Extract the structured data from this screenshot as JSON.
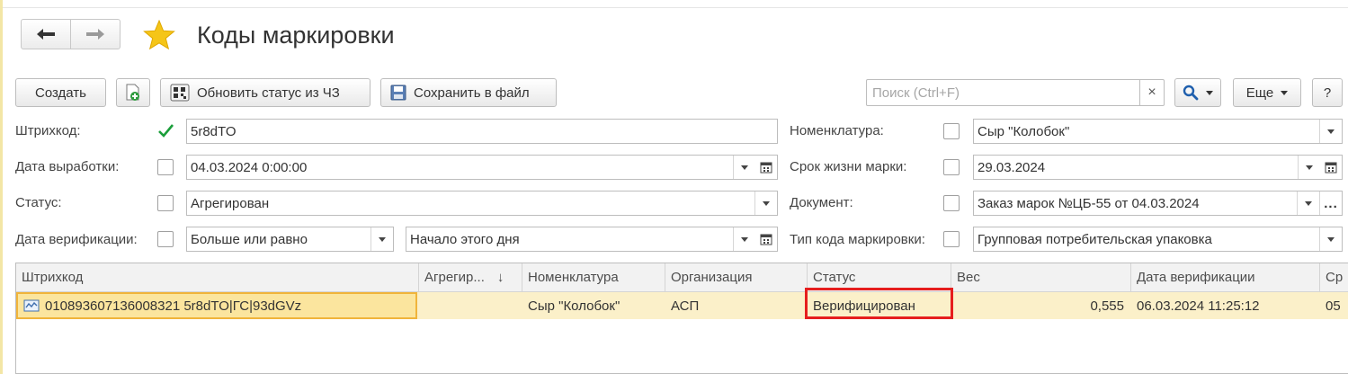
{
  "window": {
    "title": "Коды маркировки"
  },
  "toolbar": {
    "create_label": "Создать",
    "update_status_label": "Обновить статус из ЧЗ",
    "save_file_label": "Сохранить в файл",
    "search_placeholder": "Поиск (Ctrl+F)",
    "clear_symbol": "×",
    "more_label": "Еще",
    "help_label": "?"
  },
  "filters": {
    "barcode": {
      "label": "Штрихкод:",
      "checked": true,
      "value": "5r8dTO"
    },
    "production_date": {
      "label": "Дата выработки:",
      "checked": false,
      "value": "04.03.2024  0:00:00"
    },
    "status": {
      "label": "Статус:",
      "checked": false,
      "value": "Агрегирован"
    },
    "verification_date": {
      "label": "Дата верификации:",
      "checked": false,
      "condition": "Больше или равно",
      "value": "Начало этого дня"
    },
    "nomenclature": {
      "label": "Номенклатура:",
      "checked": false,
      "value": "Сыр \"Колобок\""
    },
    "mark_lifetime": {
      "label": "Срок жизни марки:",
      "checked": false,
      "value": "29.03.2024"
    },
    "document": {
      "label": "Документ:",
      "checked": false,
      "value": "Заказ марок №ЦБ-55 от 04.03.2024",
      "more": "..."
    },
    "code_type": {
      "label": "Тип кода маркировки:",
      "checked": false,
      "value": "Групповая потребительская упаковка"
    }
  },
  "table": {
    "columns": [
      "Штрихкод",
      "Агрегир...",
      "Номенклатура",
      "Организация",
      "Статус",
      "Вес",
      "Дата верификации",
      "Ср"
    ],
    "sort_indicator": "↓",
    "rows": [
      {
        "barcode": "010893607136008321 5r8dTO|ГС|93dGVz",
        "aggregated": "",
        "nomenclature": "Сыр \"Колобок\"",
        "organization": "АСП",
        "status": "Верифицирован",
        "weight": "0,555",
        "verification_date": "06.03.2024 11:25:12",
        "extra": "05"
      }
    ]
  },
  "colors": {
    "selection_row": "#fbf0c9",
    "selected_cell_border": "#f0b43a",
    "highlight_box": "#e61e1e",
    "star": "#f5c518",
    "check": "#1a9e3a"
  }
}
